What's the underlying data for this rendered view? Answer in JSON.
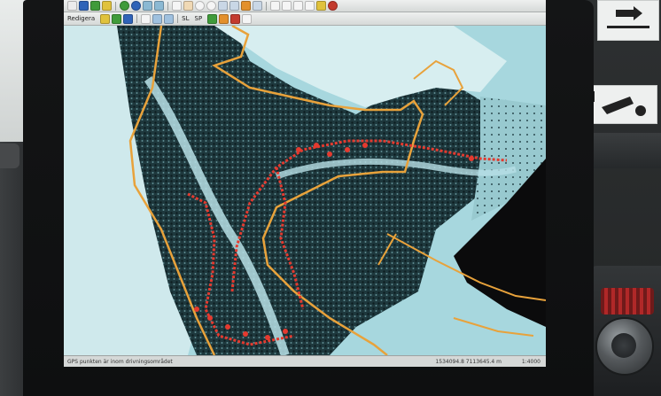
{
  "toolbar": {
    "mode_label": "Redigera",
    "tool_label_1": "SL",
    "tool_label_2": "SP",
    "top_icons": [
      "globe-icon",
      "save-icon",
      "plus-icon",
      "minus-icon",
      "globe-icon",
      "back-arrow-icon",
      "forward-arrow-icon",
      "pointer-icon",
      "hand-icon",
      "zoom-in-icon",
      "zoom-out-icon",
      "zoom-extent-icon",
      "layers-icon",
      "lock-icon",
      "window-icon",
      "home-icon",
      "h-icon",
      "f-icon",
      "grid-icon",
      "settings-icon",
      "close-icon"
    ],
    "accent_colors": {
      "green": "#3f9b3a",
      "blue": "#2f63b8",
      "orange": "#e3902b",
      "red": "#c33a2d",
      "yellow": "#e0c23c"
    }
  },
  "status": {
    "message": "GPS punkten är inom drivningsområdet",
    "coordinates": "1534094.8 7113645.4 m",
    "scale": "1:4000"
  },
  "map": {
    "boundary_color": "#e8a23b",
    "track_color": "#e43a2f",
    "snow_color": "#a9d8df",
    "forest_color": "#1f3a3f"
  }
}
